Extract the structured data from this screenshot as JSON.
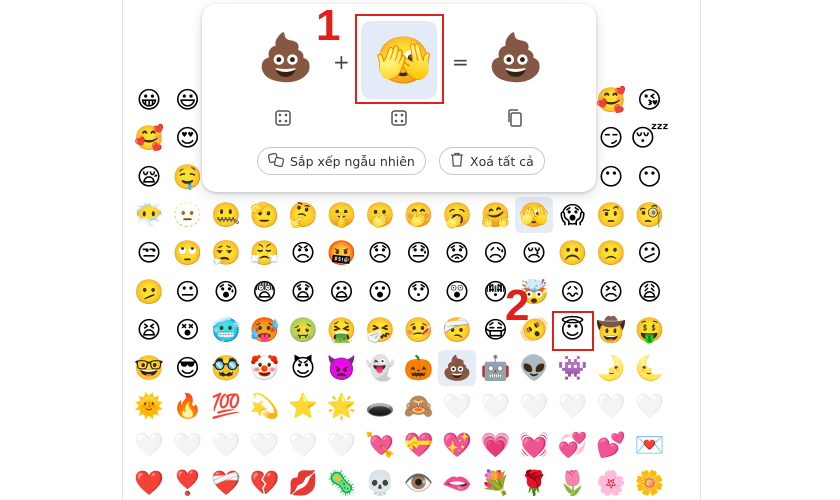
{
  "kitchen": {
    "left_emoji": "💩",
    "right_emoji": "🫣",
    "plus": "+",
    "equals": "=",
    "result_emoji": "💩"
  },
  "actions": {
    "randomize_label": "Sắp xếp ngẫu nhiên",
    "clear_label": "Xoá tất cả"
  },
  "annotations": {
    "marker_1": "1",
    "marker_2": "2"
  },
  "grid_rows": [
    [
      "😀",
      "😃",
      "",
      "",
      "",
      "",
      "",
      "",
      "",
      "",
      "",
      "",
      "🥰",
      "😘"
    ],
    [
      "🥰",
      "😍",
      "",
      "",
      "",
      "",
      "",
      "",
      "",
      "",
      "",
      "",
      "😏",
      "😴"
    ],
    [
      "😪",
      "🤤",
      "",
      "",
      "",
      "",
      "",
      "",
      "",
      "",
      "",
      "",
      "😶",
      "😶"
    ],
    [
      "😶‍🌫️",
      "🫥",
      "🤐",
      "🫡",
      "🤔",
      "🤫",
      "🫢",
      "🤭",
      "🥱",
      "🤗",
      "🫣",
      "😱",
      "🤨",
      "🧐"
    ],
    [
      "😒",
      "🙄",
      "😮‍💨",
      "😤",
      "😠",
      "🤬",
      "😞",
      "😓",
      "😟",
      "😥",
      "😢",
      "☹️",
      "🙁",
      "😕"
    ],
    [
      "🫤",
      "😐",
      "😰",
      "😨",
      "😧",
      "😦",
      "😮",
      "😯",
      "😲",
      "😳",
      "🤯",
      "😖",
      "😣",
      "😩"
    ],
    [
      "😫",
      "😵",
      "🥶",
      "🥵",
      "🤢",
      "🤮",
      "🤧",
      "🤒",
      "🤕",
      "😷",
      "🫨",
      "😇",
      "🤠",
      "🤑"
    ],
    [
      "🤓",
      "😎",
      "🥸",
      "🤡",
      "😈",
      "👿",
      "👻",
      "🎃",
      "💩",
      "🤖",
      "👽",
      "👾",
      "🌛",
      "🌜"
    ],
    [
      "🌞",
      "🔥",
      "💯",
      "💫",
      "⭐",
      "🌟",
      "🕳️",
      "🙈",
      "🤍",
      "🤍",
      "🤍",
      "🤍",
      "🤍",
      "🤍"
    ],
    [
      "🤍",
      "🤍",
      "🤍",
      "🤍",
      "🤍",
      "🤍",
      "💘",
      "💝",
      "💖",
      "💗",
      "💓",
      "💞",
      "💕",
      "💌"
    ],
    [
      "❤️",
      "❣️",
      "❤️‍🩹",
      "💔",
      "💋",
      "🦠",
      "💀",
      "👁️",
      "🫦",
      "💐",
      "🌹",
      "🌷",
      "🌸",
      "🌼"
    ]
  ],
  "grid_faded_from": {
    "row": 8,
    "col": 8
  },
  "selected_cells": [
    [
      3,
      10
    ],
    [
      7,
      8
    ]
  ],
  "colors": {
    "highlight": "#e0201b",
    "selected_bg": "#e3ebf8"
  }
}
